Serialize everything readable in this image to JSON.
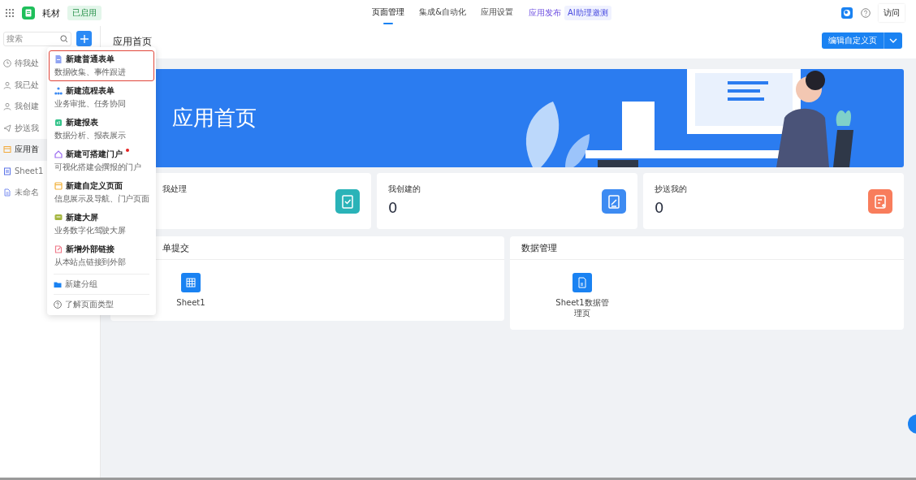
{
  "app": {
    "name": "耗材",
    "status": "已启用"
  },
  "nav": {
    "tabs": [
      {
        "label": "页面管理",
        "selected": true
      },
      {
        "label": "集成&自动化",
        "selected": false
      },
      {
        "label": "应用设置",
        "selected": false
      }
    ],
    "publish": "应用发布",
    "ai_badge": "AI助理邀测"
  },
  "toolbar": {
    "visit": "访问"
  },
  "sidebar": {
    "search": {
      "placeholder": "搜索"
    },
    "items": [
      {
        "label": "待我处",
        "kind": "clock",
        "selected": false
      },
      {
        "label": "我已处",
        "kind": "user",
        "selected": false
      },
      {
        "label": "我创建",
        "kind": "user",
        "selected": false
      },
      {
        "label": "抄送我",
        "kind": "send",
        "selected": false
      },
      {
        "label": "应用首",
        "kind": "page",
        "selected": true
      },
      {
        "label": "Sheet1",
        "kind": "sheet",
        "selected": false
      },
      {
        "label": "未命名",
        "kind": "form",
        "selected": false
      }
    ]
  },
  "menu": {
    "items": [
      {
        "kind": "option",
        "title": "新建普通表单",
        "subtitle": "数据收集、事件跟进",
        "highlighted": true,
        "new_dot": false
      },
      {
        "kind": "option",
        "title": "新建流程表单",
        "subtitle": "业务审批、任务协同",
        "highlighted": false,
        "new_dot": false
      },
      {
        "kind": "option",
        "title": "新建报表",
        "subtitle": "数据分析、报表展示",
        "highlighted": false,
        "new_dot": false
      },
      {
        "kind": "option",
        "title": "新建可搭建门户",
        "subtitle": "可视化搭建会撰报的门户",
        "highlighted": false,
        "new_dot": true
      },
      {
        "kind": "option",
        "title": "新建自定义页面",
        "subtitle": "信息展示及导航、门户页面",
        "highlighted": false,
        "new_dot": false
      },
      {
        "kind": "option",
        "title": "新建大屏",
        "subtitle": "业务数字化驾驶大屏",
        "highlighted": false,
        "new_dot": false
      },
      {
        "kind": "option",
        "title": "新增外部链接",
        "subtitle": "从本站点链接到外部",
        "highlighted": false,
        "new_dot": false
      },
      {
        "kind": "group",
        "title": "新建分组"
      },
      {
        "kind": "help",
        "title": "了解页面类型"
      }
    ]
  },
  "page": {
    "title": "应用首页",
    "edit_button": "编辑自定义页",
    "banner_title": "应用首页",
    "stats": [
      {
        "label": "我处理",
        "color": "#2ab3b8"
      },
      {
        "label": "我创建的",
        "value": "0",
        "color": "#3d8bf2"
      },
      {
        "label": "抄送我的",
        "value": "0",
        "color": "#f87d5c"
      }
    ],
    "panels": [
      {
        "title": "单提交",
        "items": [
          {
            "label": "Sheet1"
          }
        ]
      },
      {
        "title": "数据管理",
        "items": [
          {
            "label": "Sheet1数据管理页"
          }
        ]
      }
    ]
  }
}
